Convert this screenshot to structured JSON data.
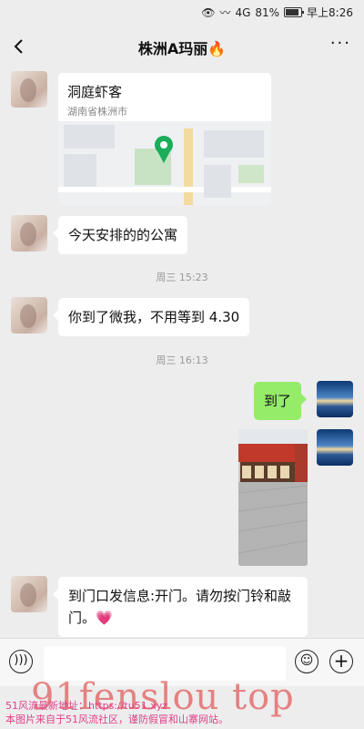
{
  "status": {
    "signal": "4G",
    "battery": "81%",
    "time": "早上8:26"
  },
  "header": {
    "title": "株洲A玛丽🔥"
  },
  "messages": {
    "location": {
      "name": "洞庭虾客",
      "address": "湖南省株洲市"
    },
    "msg1": "今天安排的的公寓",
    "ts1": "周三 15:23",
    "msg2": "你到了微我，不用等到 4.30",
    "ts2": "周三 16:13",
    "msg3": "到了",
    "msg4": "到门口发信息:开门。请勿按门铃和敲门。💗"
  },
  "input": {
    "placeholder": ""
  },
  "watermark": {
    "big": "91fenslou top",
    "line1": "51风流最新地址：https://tu51.xyz",
    "line2": "本图片来自于51风流社区，谨防假冒和山寨网站。"
  },
  "icons": {
    "back": "chevron-left-icon",
    "more": "more-dots-icon",
    "voice": "voice-icon",
    "emoji": "emoji-icon",
    "plus": "plus-icon",
    "pin": "map-pin-icon"
  }
}
